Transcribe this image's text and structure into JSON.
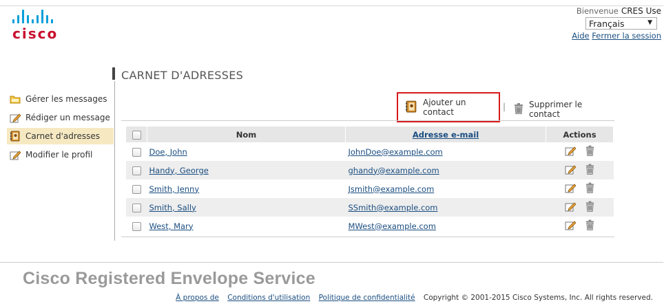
{
  "logo": {
    "text": "cisco"
  },
  "header": {
    "welcome_label": "Bienvenue",
    "user_name": "CRES Use",
    "language": "Français",
    "help_link": "Aide",
    "logout_link": "Fermer la session"
  },
  "nav": {
    "items": [
      {
        "label": "Gérer les messages",
        "icon": "folder-icon",
        "active": false
      },
      {
        "label": "Rédiger un message",
        "icon": "compose-icon",
        "active": false
      },
      {
        "label": "Carnet d'adresses",
        "icon": "address-book-icon",
        "active": true
      },
      {
        "label": "Modifier le profil",
        "icon": "edit-profile-icon",
        "active": false
      }
    ]
  },
  "page": {
    "title": "CARNET D'ADRESSES"
  },
  "toolbar": {
    "add_label": "Ajouter un contact",
    "separator": "|",
    "delete_label": "Supprimer le contact"
  },
  "table": {
    "headers": {
      "name": "Nom",
      "email": "Adresse e-mail",
      "actions": "Actions"
    },
    "rows": [
      {
        "name": "Doe, John",
        "email": "JohnDoe@example.com"
      },
      {
        "name": "Handy, George",
        "email": "ghandy@example.com"
      },
      {
        "name": "Smith, Jenny",
        "email": "Jsmith@example.com"
      },
      {
        "name": "Smith, Sally",
        "email": "SSmith@example.com"
      },
      {
        "name": "West, Mary",
        "email": "MWest@example.com"
      }
    ]
  },
  "footer": {
    "brand": "Cisco Registered Envelope Service",
    "links": [
      "À propos de",
      "Conditions d'utilisation",
      "Politique de confidentialité"
    ],
    "copyright": "Copyright © 2001-2015 Cisco Systems, Inc. All rights reserved."
  },
  "colors": {
    "accent_link": "#1a4d80",
    "highlight_box": "#d61a1a",
    "active_nav": "#f6e9c2",
    "logo_red": "#c8102e",
    "logo_blue": "#049fd9"
  }
}
